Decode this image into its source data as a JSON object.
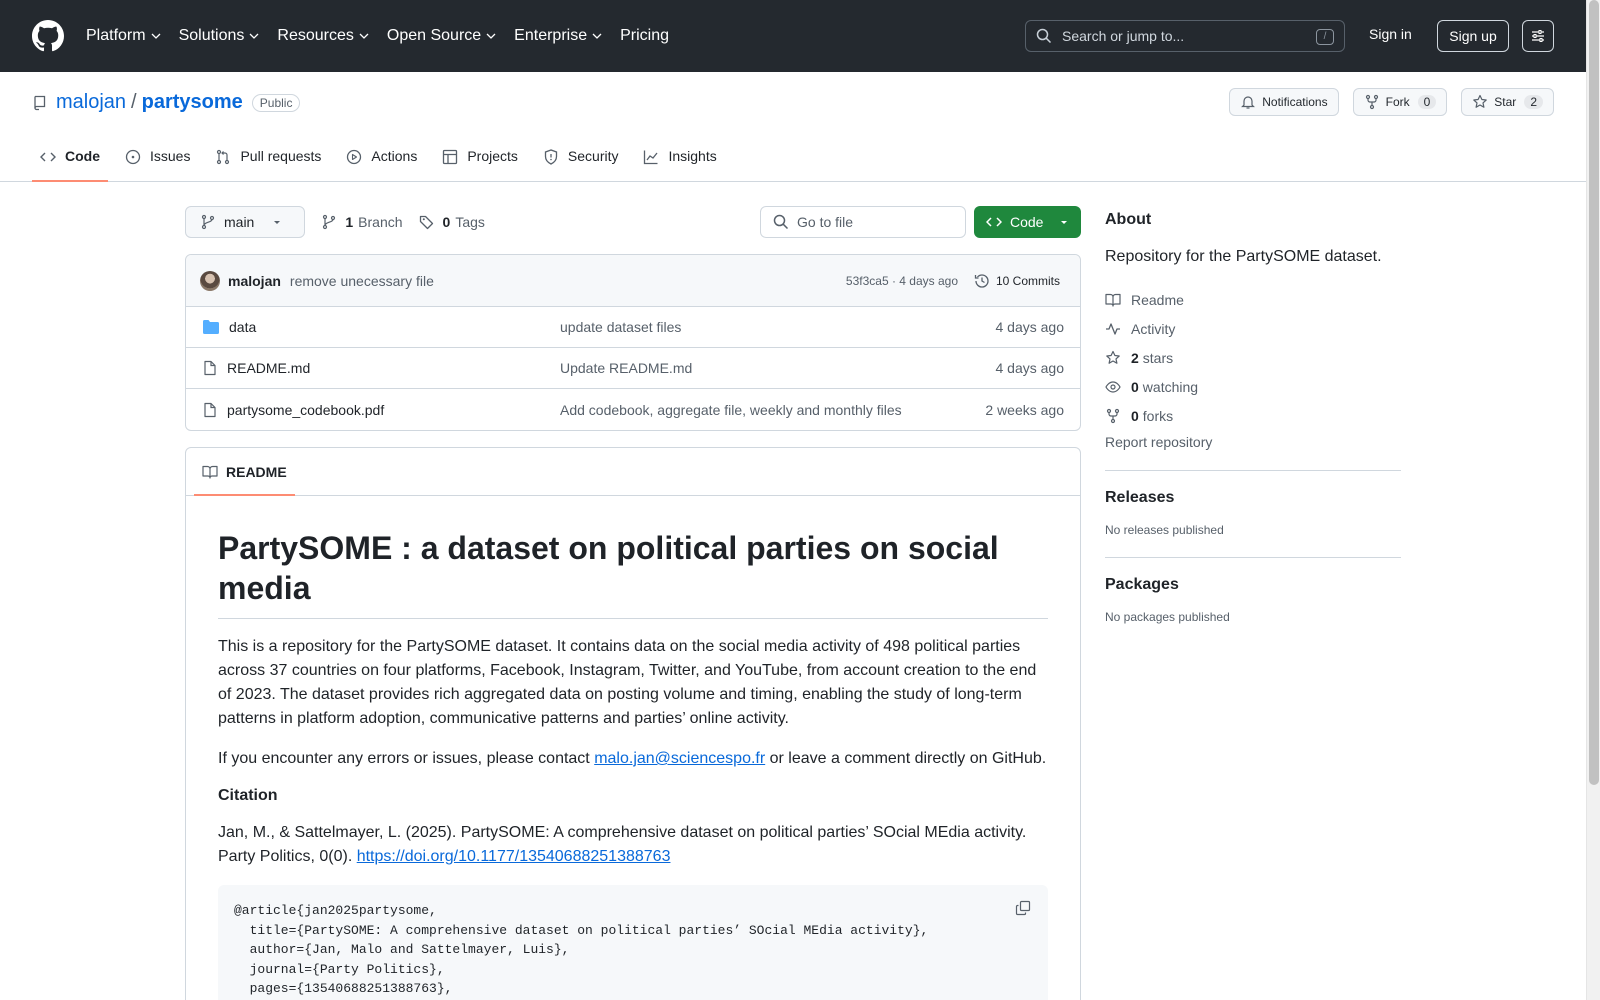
{
  "header": {
    "nav": [
      "Platform",
      "Solutions",
      "Resources",
      "Open Source",
      "Enterprise"
    ],
    "pricing": "Pricing",
    "search_placeholder": "Search or jump to...",
    "search_shortcut": "/",
    "sign_in": "Sign in",
    "sign_up": "Sign up"
  },
  "repo": {
    "owner": "malojan",
    "separator": "/",
    "name": "partysome",
    "visibility": "Public",
    "notifications_label": "Notifications",
    "fork_label": "Fork",
    "fork_count": "0",
    "star_label": "Star",
    "star_count": "2"
  },
  "tabs": [
    {
      "label": "Code",
      "icon": "code-icon"
    },
    {
      "label": "Issues",
      "icon": "issue-icon"
    },
    {
      "label": "Pull requests",
      "icon": "pull-request-icon"
    },
    {
      "label": "Actions",
      "icon": "play-icon"
    },
    {
      "label": "Projects",
      "icon": "table-icon"
    },
    {
      "label": "Security",
      "icon": "shield-icon"
    },
    {
      "label": "Insights",
      "icon": "graph-icon"
    }
  ],
  "toolbar": {
    "branch": "main",
    "branch_count": "1",
    "branch_label": "Branch",
    "tag_count": "0",
    "tag_label": "Tags",
    "goto_placeholder": "Go to file",
    "code_button": "Code"
  },
  "commit": {
    "author": "malojan",
    "message": "remove unecessary file",
    "meta": "53f3ca5 · 4 days ago",
    "count": "10 Commits"
  },
  "files": [
    {
      "name": "data",
      "type": "folder",
      "message": "update dataset files",
      "date": "4 days ago"
    },
    {
      "name": "README.md",
      "type": "file",
      "message": "Update README.md",
      "date": "4 days ago"
    },
    {
      "name": "partysome_codebook.pdf",
      "type": "file",
      "message": "Add codebook, aggregate file, weekly and monthly files",
      "date": "2 weeks ago"
    }
  ],
  "readme": {
    "tab_label": "README",
    "title": "PartySOME : a dataset on political parties on social media",
    "paragraph1": "This is a repository for the PartySOME dataset. It contains data on the social media activity of 498 political parties across 37 countries on four platforms, Facebook, Instagram, Twitter, and YouTube, from account creation to the end of 2023. The dataset provides rich aggregated data on posting volume and timing, enabling the study of long-term patterns in platform adoption, communicative patterns and parties’ online activity.",
    "contact_prefix": "If you encounter any errors or issues, please contact ",
    "contact_email": "malo.jan@sciencespo.fr",
    "contact_suffix": " or leave a comment directly on GitHub.",
    "citation_heading": "Citation",
    "citation_text": "Jan, M., & Sattelmayer, L. (2025). PartySOME: A comprehensive dataset on political parties’ SOcial MEdia activity. Party Politics, 0(0). ",
    "citation_link": "https://doi.org/10.1177/13540688251388763",
    "bibtex": "@article{jan2025partysome,\n  title={PartySOME: A comprehensive dataset on political parties’ SOcial MEdia activity},\n  author={Jan, Malo and Sattelmayer, Luis},\n  journal={Party Politics},\n  pages={13540688251388763},"
  },
  "about": {
    "heading": "About",
    "description": "Repository for the PartySOME dataset.",
    "readme": "Readme",
    "activity": "Activity",
    "stars_count": "2",
    "stars_label": "stars",
    "watching_count": "0",
    "watching_label": "watching",
    "forks_count": "0",
    "forks_label": "forks",
    "report": "Report repository"
  },
  "releases": {
    "heading": "Releases",
    "empty": "No releases published"
  },
  "packages": {
    "heading": "Packages",
    "empty": "No packages published"
  }
}
